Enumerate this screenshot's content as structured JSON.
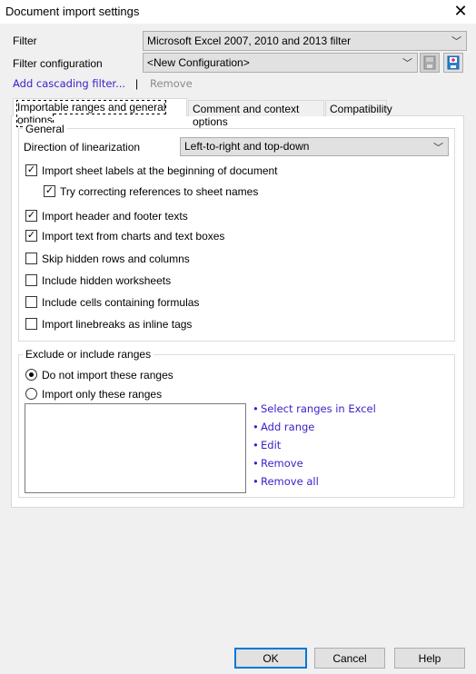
{
  "window": {
    "title": "Document import settings",
    "close_icon": "close-icon"
  },
  "filter": {
    "label": "Filter",
    "value": "Microsoft Excel 2007, 2010 and 2013 filter"
  },
  "filter_configuration": {
    "label": "Filter configuration",
    "value": "<New Configuration>",
    "save_icon": "save-disk-icon",
    "new_icon": "new-disk-icon"
  },
  "links": {
    "add_cascading": "Add cascading filter...",
    "separator": "|",
    "remove": "Remove"
  },
  "tabs": [
    {
      "label": "Importable ranges and general options",
      "active": true
    },
    {
      "label": "Comment and context options"
    },
    {
      "label": "Compatibility"
    }
  ],
  "general": {
    "legend": "General",
    "direction_label": "Direction of linearization",
    "direction_value": "Left-to-right and top-down",
    "options": [
      {
        "label": "Import sheet labels at the beginning of document",
        "checked": true
      },
      {
        "label": "Try correcting references to sheet names",
        "checked": true
      },
      {
        "label": "Import header and footer texts",
        "checked": true
      },
      {
        "label": "Import text from charts and text boxes",
        "checked": true
      },
      {
        "label": "Skip hidden rows and columns",
        "checked": false
      },
      {
        "label": "Include hidden worksheets",
        "checked": false
      },
      {
        "label": "Include cells containing formulas",
        "checked": false
      },
      {
        "label": "Import linebreaks as inline tags",
        "checked": false
      }
    ]
  },
  "ranges": {
    "legend": "Exclude or include ranges",
    "radios": [
      {
        "label": "Do not import these ranges",
        "selected": true
      },
      {
        "label": "Import only these ranges",
        "selected": false
      }
    ],
    "actions": [
      "Select ranges in Excel",
      "Add range",
      "Edit",
      "Remove",
      "Remove all"
    ]
  },
  "buttons": {
    "ok": "OK",
    "cancel": "Cancel",
    "help": "Help"
  },
  "colors": {
    "link": "#3a1fc8",
    "default_button_border": "#0078d7"
  }
}
